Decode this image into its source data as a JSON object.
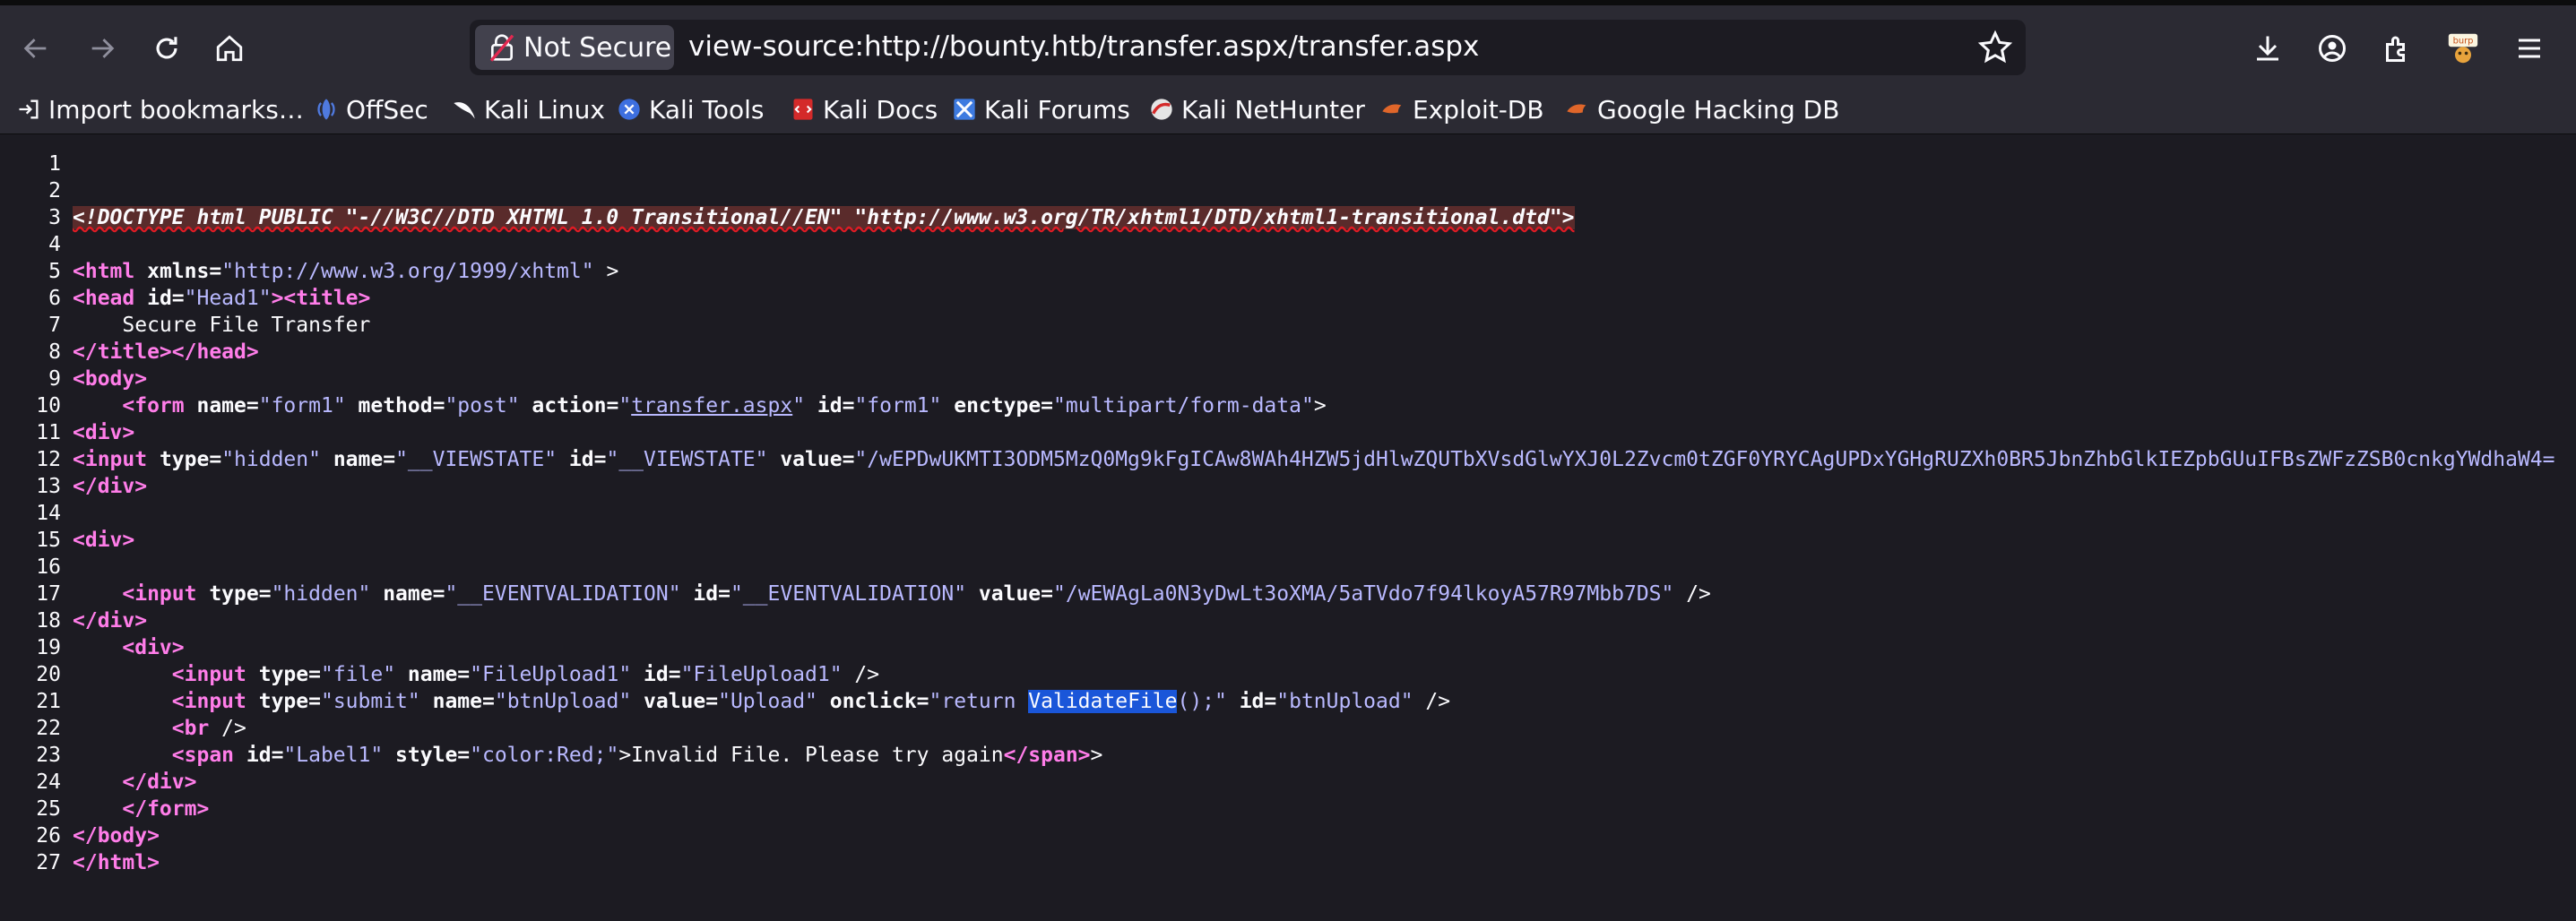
{
  "toolbar": {
    "security_label": "Not Secure",
    "url": "view-source:http://bounty.htb/transfer.aspx/transfer.aspx",
    "icons": [
      "back-icon",
      "forward-icon",
      "reload-icon",
      "home-icon",
      "bookmark-star-icon",
      "download-icon",
      "account-icon",
      "extensions-icon",
      "burp-icon",
      "menu-icon"
    ]
  },
  "bookmarks": [
    {
      "label": "Import bookmarks…",
      "icon": "import-icon"
    },
    {
      "label": "OffSec",
      "icon": "offsec-icon"
    },
    {
      "label": "Kali Linux",
      "icon": "kali-dragon-icon"
    },
    {
      "label": "Kali Tools",
      "icon": "kali-tools-icon"
    },
    {
      "label": "Kali Docs",
      "icon": "kali-docs-icon"
    },
    {
      "label": "Kali Forums",
      "icon": "kali-forums-icon"
    },
    {
      "label": "Kali NetHunter",
      "icon": "nethunter-icon"
    },
    {
      "label": "Exploit-DB",
      "icon": "exploitdb-icon"
    },
    {
      "label": "Google Hacking DB",
      "icon": "ghdb-icon"
    }
  ],
  "source": {
    "line_numbers": [
      "1",
      "2",
      "3",
      "4",
      "5",
      "6",
      "7",
      "8",
      "9",
      "10",
      "11",
      "12",
      "13",
      "14",
      "15",
      "16",
      "17",
      "18",
      "19",
      "20",
      "21",
      "22",
      "23",
      "24",
      "25",
      "26",
      "27"
    ],
    "l3": "<!DOCTYPE html PUBLIC \"-//W3C//DTD XHTML 1.0 Transitional//EN\" \"http://www.w3.org/TR/xhtml1/DTD/xhtml1-transitional.dtd\">",
    "l5_tag": "<html",
    "l5_attr": " xmlns=",
    "l5_val": "\"http://www.w3.org/1999/xhtml\"",
    "l5_end": " >",
    "l6_tag": "<head",
    "l6_attr": " id=",
    "l6_val": "\"Head1\"",
    "l6_tag2": "><title>",
    "l7_text": "    Secure File Transfer",
    "l8_tag": "</title></head>",
    "l9_tag": "<body>",
    "l10_indent": "    ",
    "l10_tag": "<form",
    "l10_a1": " name=",
    "l10_v1": "\"form1\"",
    "l10_a2": " method=",
    "l10_v2": "\"post\"",
    "l10_a3": " action=",
    "l10_v3q1": "\"",
    "l10_link": "transfer.aspx",
    "l10_v3q2": "\"",
    "l10_a4": " id=",
    "l10_v4": "\"form1\"",
    "l10_a5": " enctype=",
    "l10_v5": "\"multipart/form-data\"",
    "l10_end": ">",
    "l11_tag": "<div>",
    "l12_tag": "<input",
    "l12_a1": " type=",
    "l12_v1": "\"hidden\"",
    "l12_a2": " name=",
    "l12_v2": "\"__VIEWSTATE\"",
    "l12_a3": " id=",
    "l12_v3": "\"__VIEWSTATE\"",
    "l12_a4": " value=",
    "l12_v4": "\"/wEPDwUKMTI3ODM5MzQ0Mg9kFgICAw8WAh4HZW5jdHlwZQUTbXVsdGlwYXJ0L2Zvcm0tZGF0YRYCAgUPDxYGHgRUZXh0BR5JbnZhbGlkIEZpbGUuIFBsZWFzZSB0cnkgYWdhaW4=",
    "l13_tag": "</div>",
    "l15_tag": "<div>",
    "l17_indent": "    ",
    "l17_tag": "<input",
    "l17_a1": " type=",
    "l17_v1": "\"hidden\"",
    "l17_a2": " name=",
    "l17_v2": "\"__EVENTVALIDATION\"",
    "l17_a3": " id=",
    "l17_v3": "\"__EVENTVALIDATION\"",
    "l17_a4": " value=",
    "l17_v4": "\"/wEWAgLa0N3yDwLt3oXMA/5aTVdo7f94lkoyA57R97Mbb7DS\"",
    "l17_end": " />",
    "l18_tag": "</div>",
    "l19_indent": "    ",
    "l19_tag": "<div>",
    "l20_indent": "        ",
    "l20_tag": "<input",
    "l20_a1": " type=",
    "l20_v1": "\"file\"",
    "l20_a2": " name=",
    "l20_v2": "\"FileUpload1\"",
    "l20_a3": " id=",
    "l20_v3": "\"FileUpload1\"",
    "l20_end": " />",
    "l21_indent": "        ",
    "l21_tag": "<input",
    "l21_a1": " type=",
    "l21_v1": "\"submit\"",
    "l21_a2": " name=",
    "l21_v2": "\"btnUpload\"",
    "l21_a3": " value=",
    "l21_v3": "\"Upload\"",
    "l21_a4": " onclick=",
    "l21_v4a": "\"return ",
    "l21_sel": "ValidateFile",
    "l21_v4b": "();\"",
    "l21_a5": " id=",
    "l21_v5": "\"btnUpload\"",
    "l21_end": " />",
    "l22_indent": "        ",
    "l22_tag": "<br",
    "l22_end": " />",
    "l23_indent": "        ",
    "l23_tag": "<span",
    "l23_a1": " id=",
    "l23_v1": "\"Label1\"",
    "l23_a2": " style=",
    "l23_v2": "\"color:Red;\"",
    "l23_end": ">",
    "l23_text": "Invalid File. Please try again",
    "l23_close": "</span>",
    "l23_close2": ">",
    "l24_indent": "    ",
    "l24_tag": "</div>",
    "l25_indent": "    ",
    "l25_tag": "</form>",
    "l26_tag": "</body>",
    "l27_tag": "</html>"
  },
  "colors": {
    "tag": "#ff7de9",
    "value": "#b9b9ff",
    "background": "#1c1b22",
    "toolbar": "#2b2a33",
    "selection": "#1a56d9"
  }
}
